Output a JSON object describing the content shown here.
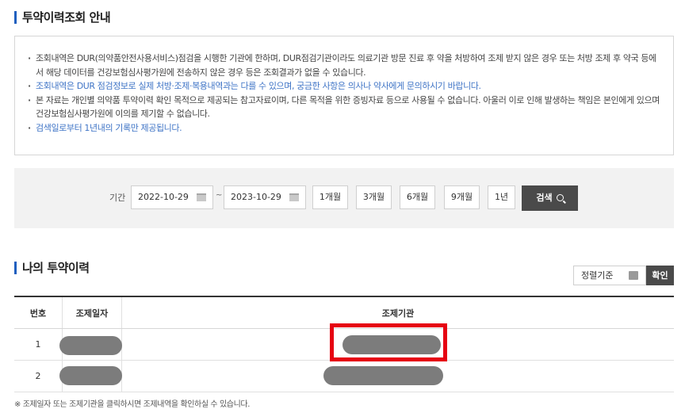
{
  "notice_section": {
    "title": "투약이력조회 안내",
    "items": [
      {
        "text": "조회내역은 DUR(의약품안전사용서비스)점검을 시행한 기관에 한하며, DUR점검기관이라도 의료기관 방문 진료 후 약을 처방하여 조제 받지 않은 경우 또는 처방 조제 후 약국 등에서 해당 데이터를 건강보험심사평가원에 전송하지 않은 경우 등은 조회결과가 없을 수 있습니다.",
        "style": "normal"
      },
      {
        "text": "조회내역은 DUR 점검정보로 실제 처방·조제·복용내역과는 다를 수 있으며, 궁금한 사항은 의사나 약사에게 문의하시기 바랍니다.",
        "style": "blue"
      },
      {
        "text": "본 자료는 개인별 의약품 투약이력 확인 목적으로 제공되는 참고자료이며, 다른 목적을 위한 증빙자료 등으로 사용될 수 없습니다. 아울러 이로 인해 발생하는 책임은 본인에게 있으며 건강보험심사평가원에 이의를 제기할 수 없습니다.",
        "style": "normal"
      },
      {
        "text": "검색일로부터 1년내의 기록만 제공됩니다.",
        "style": "blue"
      }
    ]
  },
  "search": {
    "period_label": "기간",
    "start_date": "2022-10-29",
    "end_date": "2023-10-29",
    "separator": "~",
    "period_buttons": [
      "1개월",
      "3개월",
      "6개월",
      "9개월",
      "1년"
    ],
    "search_label": "검색"
  },
  "history_section": {
    "title": "나의 투약이력",
    "sort_select": "정렬기준",
    "confirm_label": "확인"
  },
  "table": {
    "headers": [
      "번호",
      "조제일자",
      "조제기관"
    ],
    "rows": [
      {
        "no": "1"
      },
      {
        "no": "2"
      }
    ]
  },
  "footnote": "※ 조제일자 또는 조제기관을 클릭하시면 조제내역을 확인하실 수 있습니다.",
  "colors": {
    "accent_blue": "#1f5fbf",
    "notice_blue": "#3f74c6",
    "dark_button": "#4a4a4a",
    "highlight_red": "#e60012"
  }
}
